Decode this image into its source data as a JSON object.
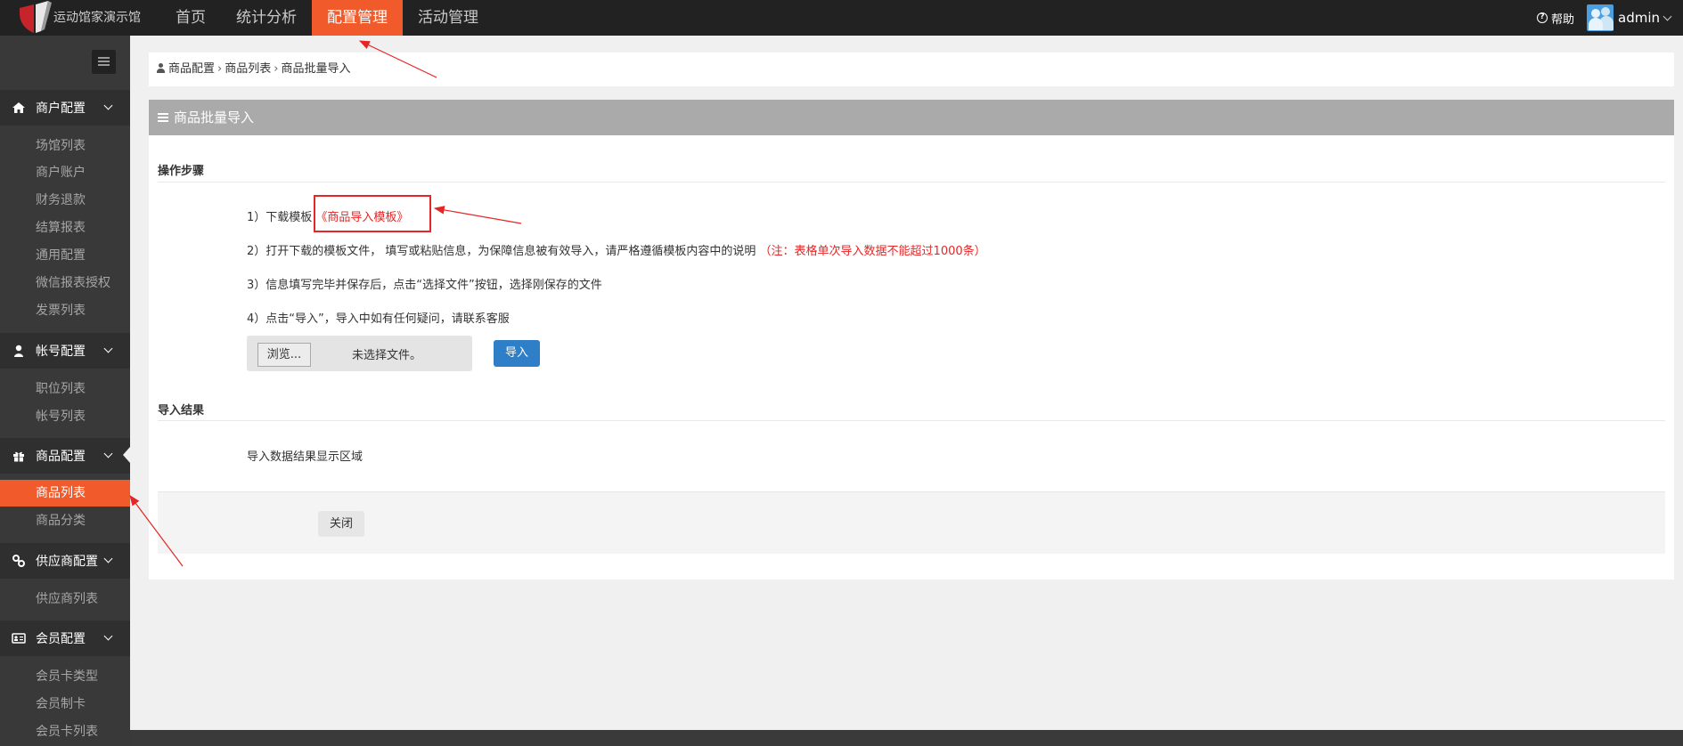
{
  "app": {
    "title": "运动馆家演示馆"
  },
  "topnav": {
    "items": [
      {
        "label": "首页"
      },
      {
        "label": "统计分析"
      },
      {
        "label": "配置管理",
        "active": true
      },
      {
        "label": "活动管理"
      }
    ],
    "help_label": "帮助",
    "user_name": "admin"
  },
  "sidebar": {
    "groups": [
      {
        "label": "商户配置",
        "icon": "home-icon",
        "items": [
          "场馆列表",
          "商户账户",
          "财务退款",
          "结算报表",
          "通用配置",
          "微信报表授权",
          "发票列表"
        ]
      },
      {
        "label": "帐号配置",
        "icon": "user-icon",
        "items": [
          "职位列表",
          "帐号列表"
        ]
      },
      {
        "label": "商品配置",
        "icon": "gift-icon",
        "items": [
          "商品列表",
          "商品分类"
        ],
        "active_item": "商品列表"
      },
      {
        "label": "供应商配置",
        "icon": "link-icon",
        "items": [
          "供应商列表"
        ]
      },
      {
        "label": "会员配置",
        "icon": "id-card-icon",
        "items": [
          "会员卡类型",
          "会员制卡",
          "会员卡列表"
        ]
      }
    ]
  },
  "breadcrumb": [
    "商品配置",
    "商品列表",
    "商品批量导入"
  ],
  "panel": {
    "title": "商品批量导入",
    "steps_title": "操作步骤",
    "step1_prefix": "1）下载模板",
    "step1_link": "《商品导入模板》",
    "step2_text": "2）打开下载的模板文件， 填写或粘贴信息，为保障信息被有效导入，请严格遵循模板内容中的说明",
    "step2_note": "（注：表格单次导入数据不能超过1000条）",
    "step3_text": "3）信息填写完毕并保存后，点击“选择文件”按钮，选择刚保存的文件",
    "step4_text": "4）点击“导入”，导入中如有任何疑问，请联系客服",
    "browse_label": "浏览...",
    "no_file_label": "未选择文件。",
    "import_label": "导入",
    "result_title": "导入结果",
    "result_placeholder": "导入数据结果显示区域",
    "close_label": "关闭"
  },
  "colors": {
    "accent": "#f15a2b",
    "topbar": "#222222",
    "sidebar": "#393939",
    "primary_button": "#2e7fc7",
    "annotation_red": "#e52626"
  }
}
